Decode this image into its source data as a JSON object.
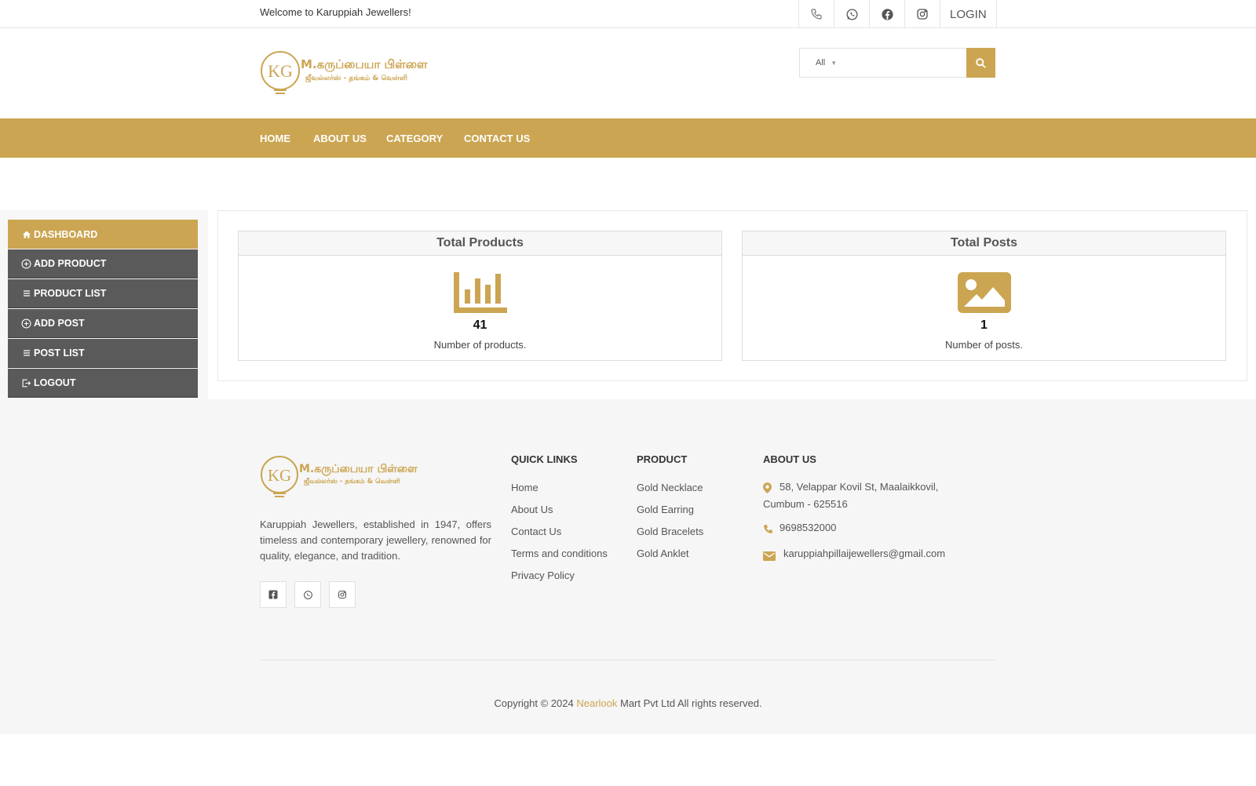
{
  "topbar": {
    "welcome": "Welcome to Karuppiah Jewellers!",
    "icons": [
      "phone-icon",
      "whatsapp-icon",
      "facebook-icon",
      "instagram-icon"
    ],
    "login": "LOGIN"
  },
  "header": {
    "logo_mark": "KG",
    "logo_name": "M.கருப்பையா பிள்ளை",
    "logo_tagline": "ஜீவல்லர்ஸ் - தங்கம் & வெள்ளி",
    "search": {
      "category": "All",
      "placeholder": ""
    }
  },
  "nav": {
    "home": "HOME",
    "about": "ABOUT US",
    "category": "CATEGORY",
    "contact": "CONTACT US"
  },
  "sidebar": {
    "items": [
      {
        "label": "DASHBOARD",
        "icon": "home-icon"
      },
      {
        "label": "ADD PRODUCT",
        "icon": "plus-circle-icon"
      },
      {
        "label": "PRODUCT LIST",
        "icon": "list-icon"
      },
      {
        "label": "ADD POST",
        "icon": "plus-circle-icon"
      },
      {
        "label": "POST LIST",
        "icon": "list-icon"
      },
      {
        "label": "LOGOUT",
        "icon": "logout-icon"
      }
    ]
  },
  "dashboard": {
    "products": {
      "title": "Total Products",
      "count": "41",
      "desc": "Number of products.",
      "icon": "bar-chart-icon"
    },
    "posts": {
      "title": "Total Posts",
      "count": "1",
      "desc": "Number of posts.",
      "icon": "image-icon"
    }
  },
  "footer": {
    "description": "Karuppiah Jewellers, established in 1947, offers timeless and contemporary jewellery, renowned for quality, elegance, and tradition.",
    "social": [
      "facebook-icon",
      "whatsapp-icon",
      "instagram-icon"
    ],
    "quick_links": {
      "heading": "QUICK LINKS",
      "links": [
        "Home",
        "About Us",
        "Contact Us",
        "Terms and conditions",
        "Privacy Policy"
      ]
    },
    "product": {
      "heading": "PRODUCT",
      "links": [
        "Gold Necklace",
        "Gold Earring",
        "Gold Bracelets",
        "Gold Anklet"
      ]
    },
    "about": {
      "heading": "ABOUT US",
      "address_line1": "58, Velappar Kovil St, Maalaikkovil,",
      "address_line2": "Cumbum - 625516",
      "phone": "9698532000",
      "email": "karuppiahpillaijewellers@gmail.com"
    },
    "copyright": {
      "prefix": "Copyright © 2024",
      "brand": "Nearlook",
      "suffix": "Mart Pvt Ltd All rights reserved."
    }
  },
  "colors": {
    "accent": "#cba552",
    "sidebar": "#5a5a5a"
  }
}
